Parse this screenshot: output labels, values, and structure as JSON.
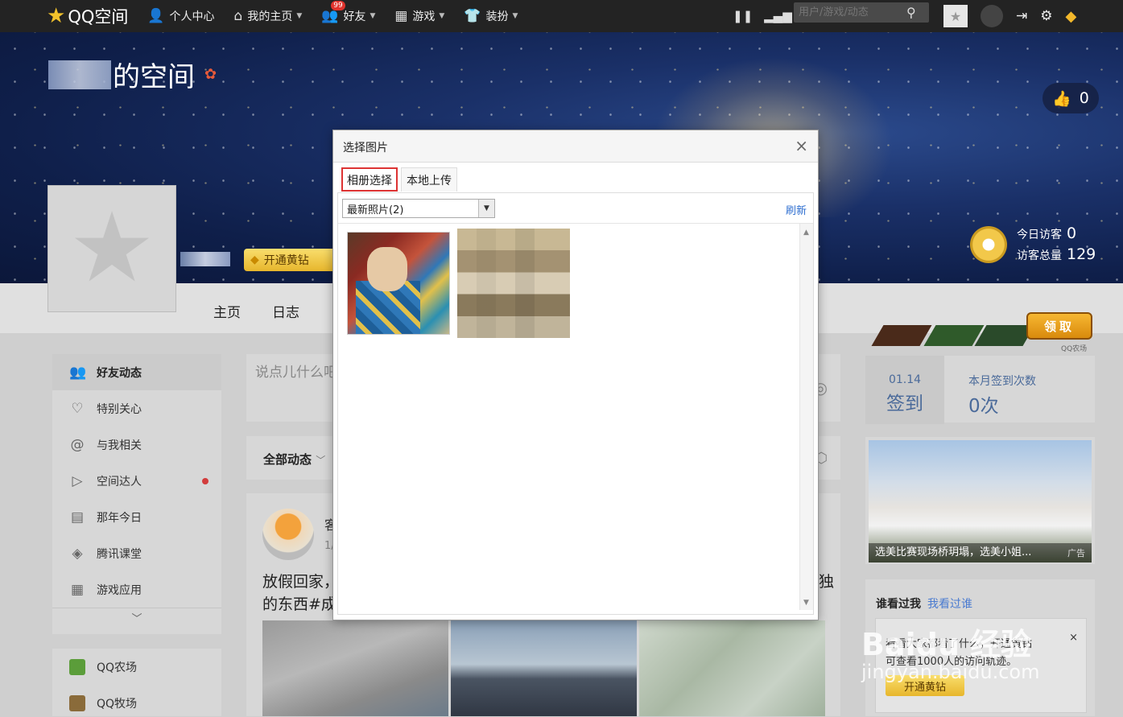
{
  "topbar": {
    "logo": "QQ空间",
    "nav": [
      {
        "label": "个人中心",
        "icon": "person-icon"
      },
      {
        "label": "我的主页",
        "icon": "home-icon"
      },
      {
        "label": "好友",
        "icon": "friends-icon",
        "badge": "99"
      },
      {
        "label": "游戏",
        "icon": "grid-icon"
      },
      {
        "label": "装扮",
        "icon": "shirt-icon"
      }
    ],
    "search_placeholder": "用户/游戏/动态"
  },
  "banner": {
    "title_suffix": "的空间",
    "like_count": "0",
    "vip_button": "开通黄钻",
    "visitors_today_label": "今日访客",
    "visitors_today": "0",
    "visitors_total_label": "访客总量",
    "visitors_total": "129"
  },
  "tabs": [
    "主页",
    "日志"
  ],
  "gifts": {
    "button": "领取",
    "label": "QQ农场"
  },
  "sidebar": {
    "items": [
      {
        "label": "好友动态",
        "icon": "friends-icon",
        "active": true
      },
      {
        "label": "特别关心",
        "icon": "heart-icon"
      },
      {
        "label": "与我相关",
        "icon": "at-icon"
      },
      {
        "label": "空间达人",
        "icon": "play-icon",
        "dot": true
      },
      {
        "label": "那年今日",
        "icon": "calendar-icon"
      },
      {
        "label": "腾讯课堂",
        "icon": "graduation-icon"
      },
      {
        "label": "游戏应用",
        "icon": "grid-icon"
      }
    ],
    "apps": [
      {
        "label": "QQ农场",
        "color": "#5b9d3a"
      },
      {
        "label": "QQ牧场",
        "color": "#8a6b3a"
      }
    ]
  },
  "composer": {
    "placeholder": "说点儿什么吧"
  },
  "feed": {
    "header": "全部动态",
    "name": "客",
    "date": "1/",
    "text_line1": "放假回家，",
    "text_line2": "的东西#成",
    "text_right": "独"
  },
  "signin": {
    "date": "01.14",
    "button": "签到",
    "count_label": "本月签到次数",
    "count": "0次"
  },
  "ad": {
    "caption": "选美比赛现场桥玥塌，选美小姐...",
    "tag": "广告"
  },
  "visitors_box": {
    "tab1": "谁看过我",
    "tab2": "我看过谁",
    "line1": "看看大家都看了什么，开通黄钻",
    "line2": "可查看1000人的访问轨迹。",
    "button": "开通黄钻",
    "close": "×"
  },
  "modal": {
    "title": "选择图片",
    "close": "×",
    "tabs": [
      "相册选择",
      "本地上传"
    ],
    "album_selected": "最新照片(2)",
    "refresh": "刷新"
  },
  "watermark": {
    "brand": "Baidu 经验",
    "url": "jingyan.baidu.com"
  }
}
